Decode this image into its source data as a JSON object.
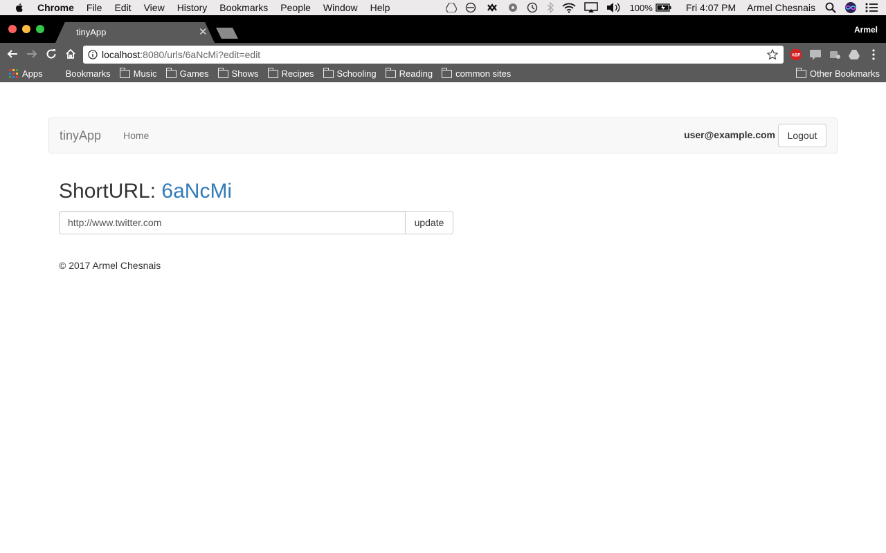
{
  "menubar": {
    "items": [
      "Chrome",
      "File",
      "Edit",
      "View",
      "History",
      "Bookmarks",
      "People",
      "Window",
      "Help"
    ],
    "battery": "100%",
    "clock": "Fri 4:07 PM",
    "user": "Armel Chesnais"
  },
  "browser": {
    "tab_title": "tinyApp",
    "profile_name": "Armel",
    "address_host": "localhost",
    "address_path": ":8080/urls/6aNcMi?edit=edit",
    "adblock_label": "ABP"
  },
  "bookmarks": {
    "apps": "Apps",
    "bookmarks_label": "Bookmarks",
    "folders": [
      "Music",
      "Games",
      "Shows",
      "Recipes",
      "Schooling",
      "Reading",
      "common sites"
    ],
    "other": "Other Bookmarks"
  },
  "navbar": {
    "brand": "tinyApp",
    "home": "Home",
    "user_email": "user@example.com",
    "logout": "Logout"
  },
  "main": {
    "heading_prefix": "ShortURL:",
    "short_url": "6aNcMi",
    "long_url_value": "http://www.twitter.com",
    "update_label": "update"
  },
  "footer": {
    "copyright": "© 2017 Armel Chesnais"
  },
  "colors": {
    "link": "#337ab7",
    "navbar_bg": "#f8f8f8",
    "chrome_toolbar": "#5a5a5a"
  }
}
